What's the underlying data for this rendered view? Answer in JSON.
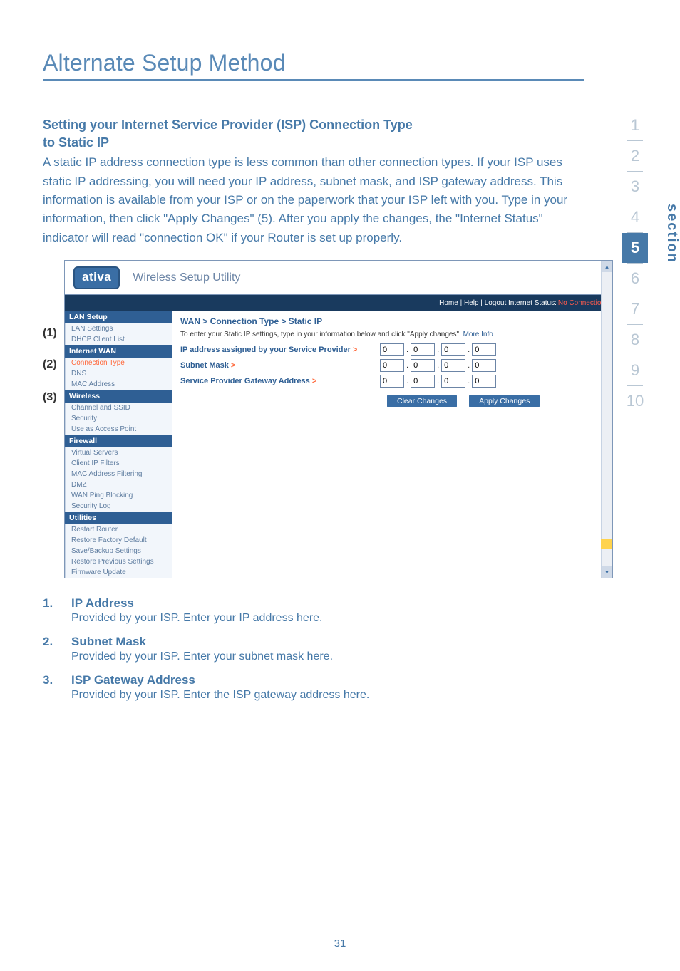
{
  "page": {
    "title": "Alternate Setup Method",
    "number": "31"
  },
  "intro": {
    "subhead_l1": "Setting your Internet Service Provider (ISP) Connection Type",
    "subhead_l2": "to Static IP",
    "body": "A static IP address connection type is less common than other connection types. If your ISP uses static IP addressing, you will need your IP address, subnet mask, and ISP gateway address. This information is available from your ISP or on the paperwork that your ISP left with you. Type in your information, then click \"Apply Changes\" (5). After you apply the changes, the \"Internet Status\" indicator will read \"connection OK\" if your Router is set up properly."
  },
  "callouts": {
    "c1": "(1)",
    "c2": "(2)",
    "c3": "(3)"
  },
  "shot": {
    "brand": "ativa",
    "brand_title": "Wireless Setup Utility",
    "status_links": "Home | Help | Logout   Internet Status:",
    "status_value": "No Connection",
    "nav": {
      "lan_setup": "LAN Setup",
      "lan_settings": "LAN Settings",
      "dhcp_list": "DHCP Client List",
      "internet_wan": "Internet WAN",
      "connection_type": "Connection Type",
      "dns": "DNS",
      "mac_address": "MAC Address",
      "wireless": "Wireless",
      "channel_ssid": "Channel and SSID",
      "security": "Security",
      "use_ap": "Use as Access Point",
      "firewall": "Firewall",
      "virtual_servers": "Virtual Servers",
      "client_ip_filters": "Client IP Filters",
      "mac_filtering": "MAC Address Filtering",
      "dmz": "DMZ",
      "wan_ping": "WAN Ping Blocking",
      "security_log": "Security Log",
      "utilities": "Utilities",
      "restart_router": "Restart Router",
      "restore_factory": "Restore Factory Default",
      "save_backup": "Save/Backup Settings",
      "restore_prev": "Restore Previous Settings",
      "firmware": "Firmware Update"
    },
    "main": {
      "breadcrumb": "WAN > Connection Type > Static IP",
      "hint_text": "To enter your Static IP settings, type in your information below and click \"Apply changes\".",
      "hint_more": "More Info",
      "row1": "IP address assigned by your Service Provider",
      "row2": "Subnet Mask",
      "row3": "Service Provider Gateway Address",
      "gt": ">",
      "ip_val": "0",
      "btn_clear": "Clear Changes",
      "btn_apply": "Apply Changes"
    }
  },
  "list": {
    "n1": "1.",
    "h1": "IP Address",
    "t1": "Provided by your ISP. Enter your IP address here.",
    "n2": "2.",
    "h2": "Subnet Mask",
    "t2": "Provided by your ISP. Enter your subnet mask here.",
    "n3": "3.",
    "h3": "ISP Gateway Address",
    "t3": "Provided by your ISP. Enter the ISP gateway address here."
  },
  "sidenav": {
    "label": "section",
    "i1": "1",
    "i2": "2",
    "i3": "3",
    "i4": "4",
    "i5": "5",
    "i6": "6",
    "i7": "7",
    "i8": "8",
    "i9": "9",
    "i10": "10"
  }
}
